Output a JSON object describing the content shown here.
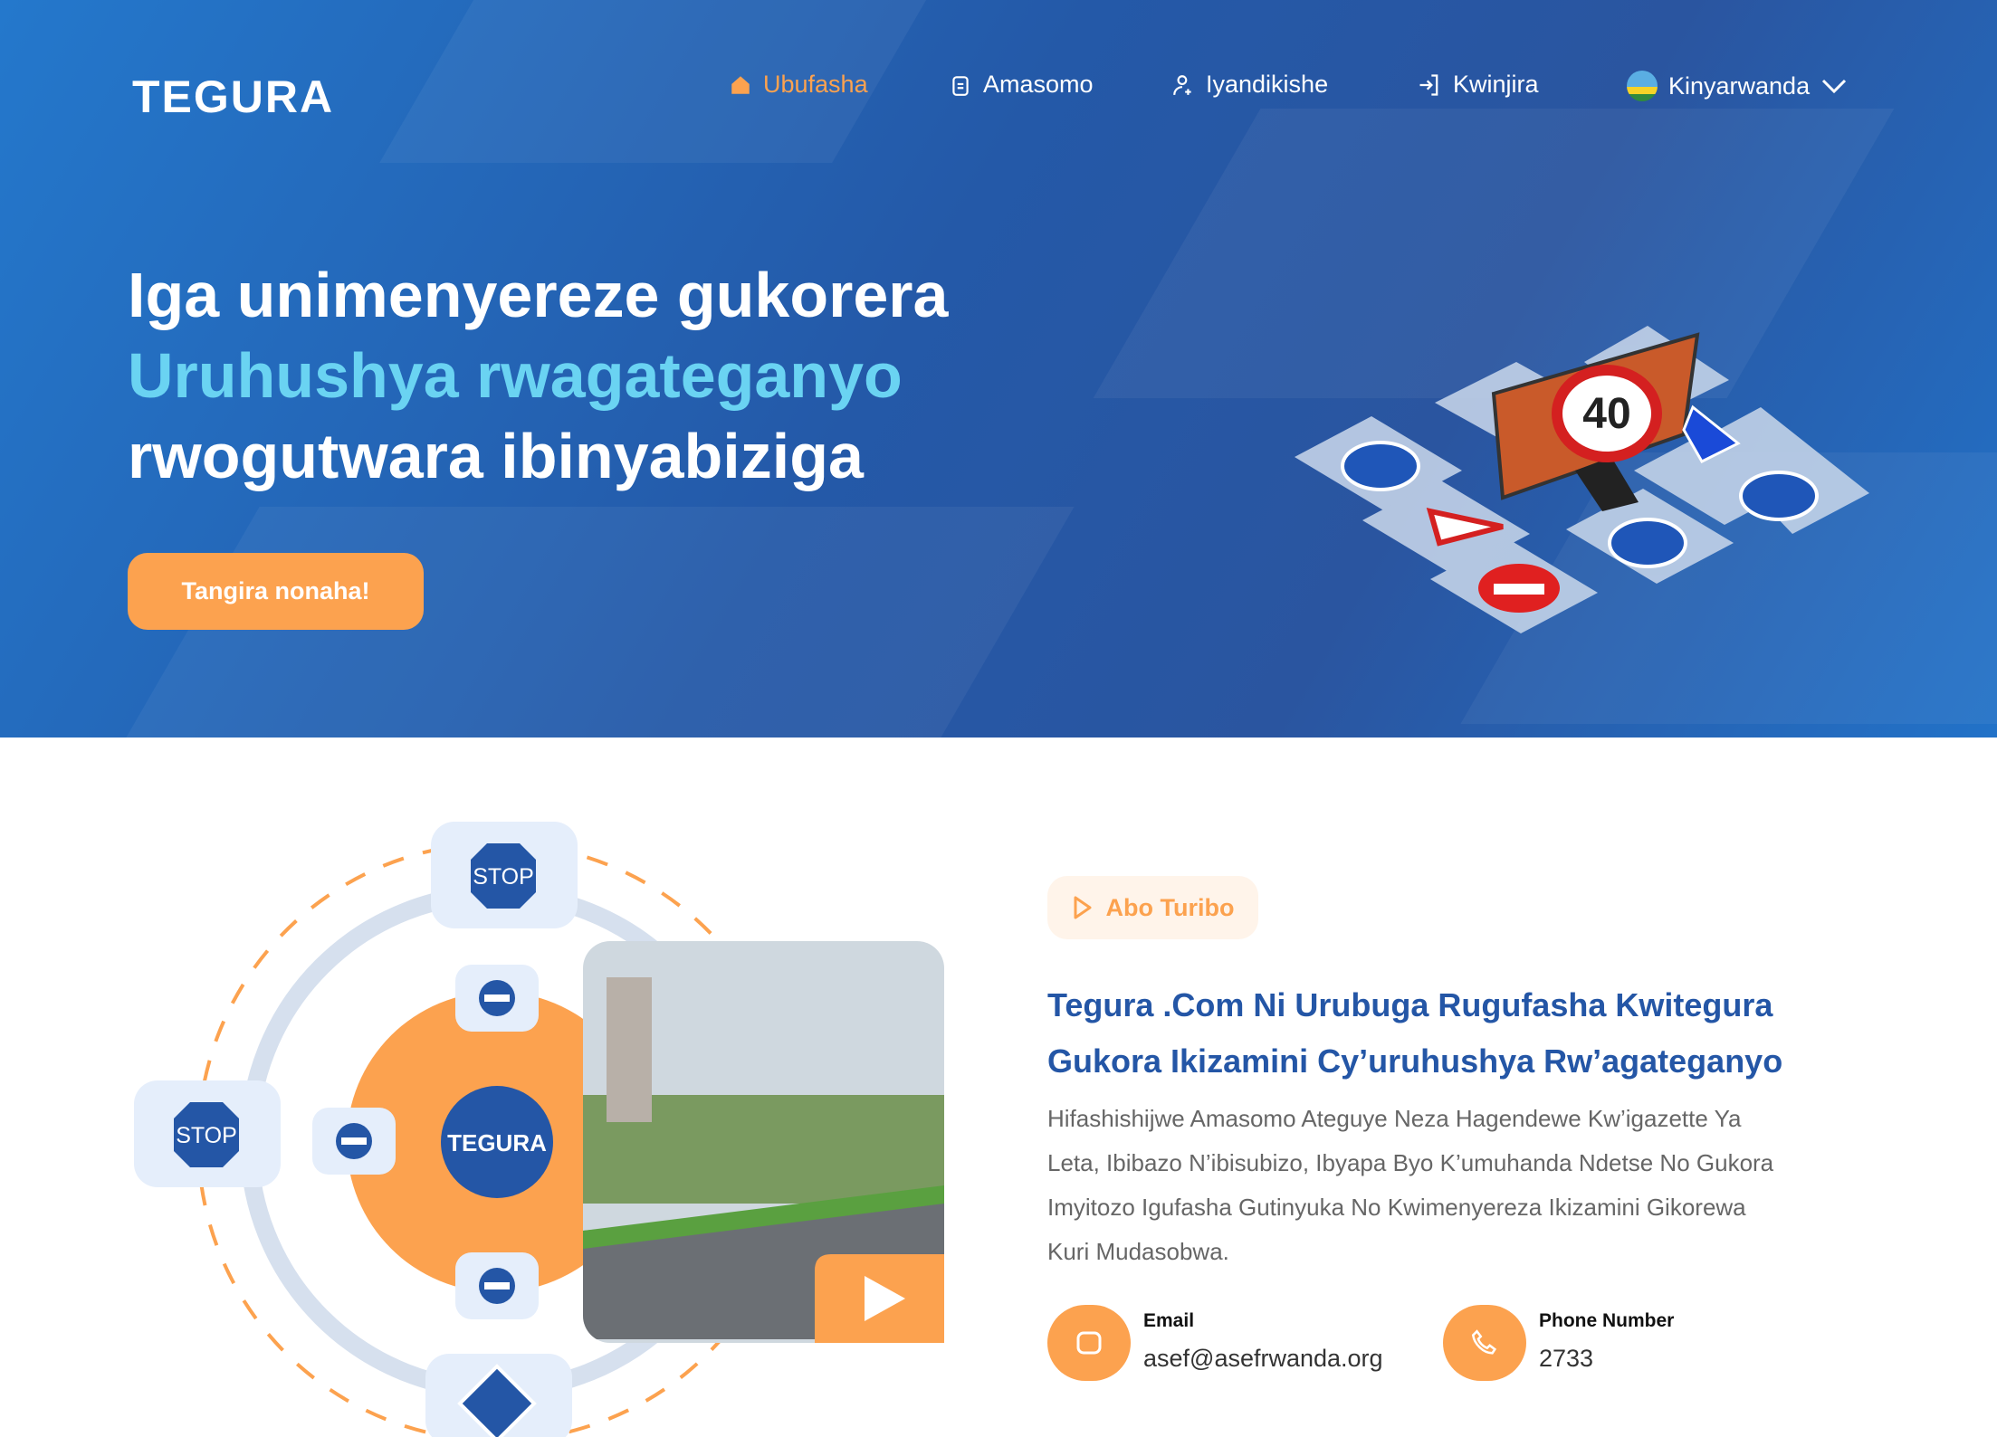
{
  "brand": {
    "logo": "TEGURA"
  },
  "nav": {
    "items": [
      {
        "label": "Ubufasha",
        "icon": "home-icon"
      },
      {
        "label": "Amasomo",
        "icon": "clipboard-icon"
      },
      {
        "label": "Iyandikishe",
        "icon": "user-add-icon"
      },
      {
        "label": "Kwinjira",
        "icon": "login-icon"
      }
    ],
    "language": "Kinyarwanda"
  },
  "hero": {
    "line1": "Iga unimenyereze gukorera",
    "line2": "Uruhushya rwagateganyo",
    "line3": "rwogutwara ibinyabiziga",
    "cta": "Tangira nonaha!",
    "sign_speed": "40"
  },
  "about": {
    "badge": "Abo Turibo",
    "title": "Tegura .Com Ni Urubuga Rugufasha Kwitegura Gukora Ikizamini Cy’uruhushya Rw’agateganyo",
    "paragraph": "Hifashishijwe Amasomo Ateguye Neza Hagendewe Kw’igazette Ya Leta, Ibibazo N’ibisubizo, Ibyapa Byo K’umuhanda Ndetse No Gukora Imyitozo Igufasha Gutinyuka No Kwimenyereza Ikizamini Gikorewa Kuri Mudasobwa.",
    "email_label": "Email",
    "email": "asef@asefrwanda.org",
    "phone_label": "Phone Number",
    "phone": "2733",
    "stop": "STOP",
    "center_logo": "TEGURA"
  },
  "colors": {
    "primary": "#2456a6",
    "accent": "#fca24f",
    "light": "#6ad3f2"
  }
}
